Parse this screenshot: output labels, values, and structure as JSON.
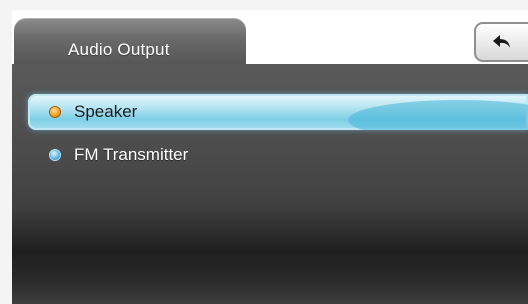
{
  "header": {
    "tab_title": "Audio Output"
  },
  "back_button": {
    "icon": "back-arrow-icon"
  },
  "options": [
    {
      "label": "Speaker",
      "selected": true,
      "indicator_color": "#f39c1a"
    },
    {
      "label": "FM Transmitter",
      "selected": false,
      "indicator_color": "#56b6e6"
    }
  ]
}
